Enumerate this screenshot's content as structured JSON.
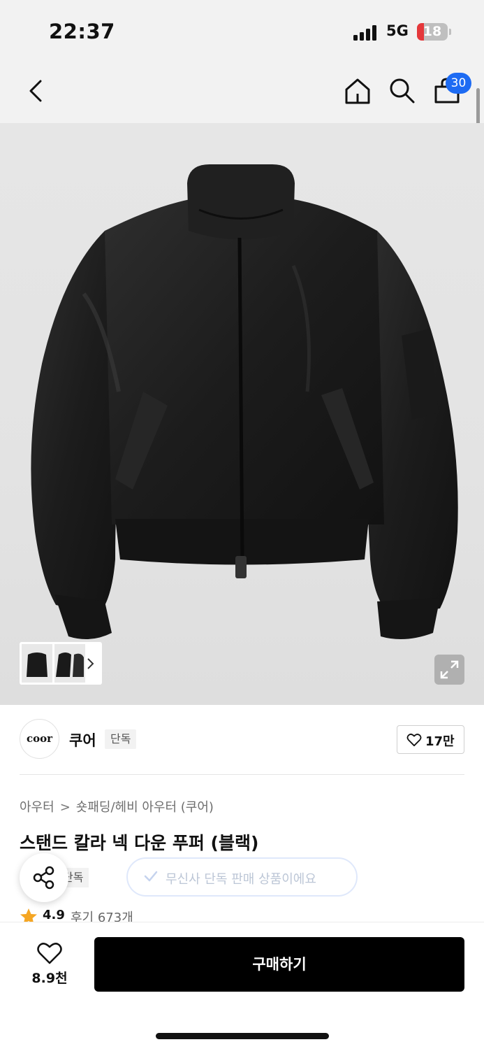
{
  "status_bar": {
    "time": "22:37",
    "network": "5G",
    "battery": "18"
  },
  "nav": {
    "cart_count": "30"
  },
  "colors": {
    "accent": "#1d6bf3",
    "buy_button": "#000000",
    "battery_low": "#e5383b",
    "star": "#f5a623"
  },
  "brand": {
    "logo_text": "coor",
    "name": "쿠어",
    "tag": "단독",
    "like_count": "17만"
  },
  "breadcrumb": {
    "items": [
      "아우터",
      "숏패딩/헤비 아우터 (쿠어)"
    ],
    "separator": ">"
  },
  "product": {
    "title": "스탠드 칼라 넥 다운 푸퍼 (블랙)",
    "exclusive_tag": "단독",
    "exclusive_notice": "무신사 단독 판매 상품이에요",
    "rating": "4.9",
    "reviews": "후기 673개"
  },
  "bottom_bar": {
    "wish_count": "8.9천",
    "buy_label": "구매하기"
  },
  "icons": [
    "back-icon",
    "home-icon",
    "search-icon",
    "cart-icon",
    "chevron-right-icon",
    "expand-icon",
    "heart-icon",
    "share-icon",
    "check-icon",
    "star-icon"
  ]
}
